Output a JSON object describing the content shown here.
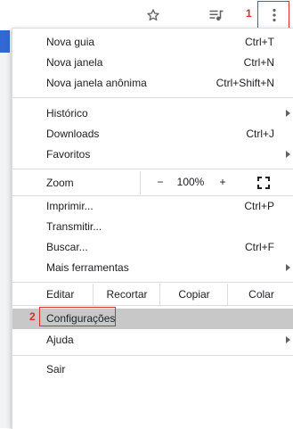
{
  "annotations": {
    "step1": "1",
    "step2": "2",
    "color": "#d93025"
  },
  "toolbar": {
    "icons": [
      "star-icon",
      "media-control-icon",
      "more-vert-icon"
    ]
  },
  "menu": {
    "group1": [
      {
        "label": "Nova guia",
        "shortcut": "Ctrl+T"
      },
      {
        "label": "Nova janela",
        "shortcut": "Ctrl+N"
      },
      {
        "label": "Nova janela anônima",
        "shortcut": "Ctrl+Shift+N"
      }
    ],
    "group2": [
      {
        "label": "Histórico",
        "has_submenu": true
      },
      {
        "label": "Downloads",
        "shortcut": "Ctrl+J"
      },
      {
        "label": "Favoritos",
        "has_submenu": true
      }
    ],
    "zoom": {
      "label": "Zoom",
      "minus": "−",
      "value": "100%",
      "plus": "+",
      "fullscreen_icon": "fullscreen-icon"
    },
    "group3": [
      {
        "label": "Imprimir...",
        "shortcut": "Ctrl+P"
      },
      {
        "label": "Transmitir..."
      },
      {
        "label": "Buscar...",
        "shortcut": "Ctrl+F"
      },
      {
        "label": "Mais ferramentas",
        "has_submenu": true
      }
    ],
    "edit": {
      "label": "Editar",
      "cut": "Recortar",
      "copy": "Copiar",
      "paste": "Colar"
    },
    "group4": [
      {
        "label": "Configurações",
        "highlighted": true
      },
      {
        "label": "Ajuda",
        "has_submenu": true
      }
    ],
    "exit": {
      "label": "Sair"
    }
  }
}
